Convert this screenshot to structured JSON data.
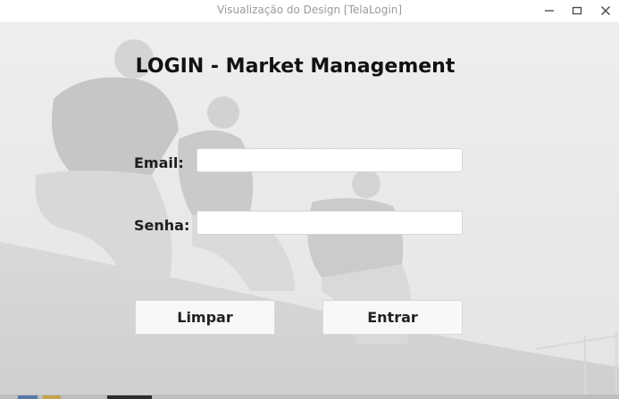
{
  "window": {
    "title": "Visualização do Design [TelaLogin]",
    "controls": {
      "minimize": "minimize-icon",
      "maximize": "maximize-icon",
      "close": "close-icon"
    }
  },
  "form": {
    "heading": "LOGIN - Market Management",
    "email_label": "Email:",
    "email_value": "",
    "password_label": "Senha:",
    "password_value": "",
    "clear_button": "Limpar",
    "submit_button": "Entrar"
  },
  "colors": {
    "background": "#ececec",
    "titlebar": "#ffffff",
    "title_text": "#9a9a9a",
    "button_bg": "#f8f8f8"
  }
}
